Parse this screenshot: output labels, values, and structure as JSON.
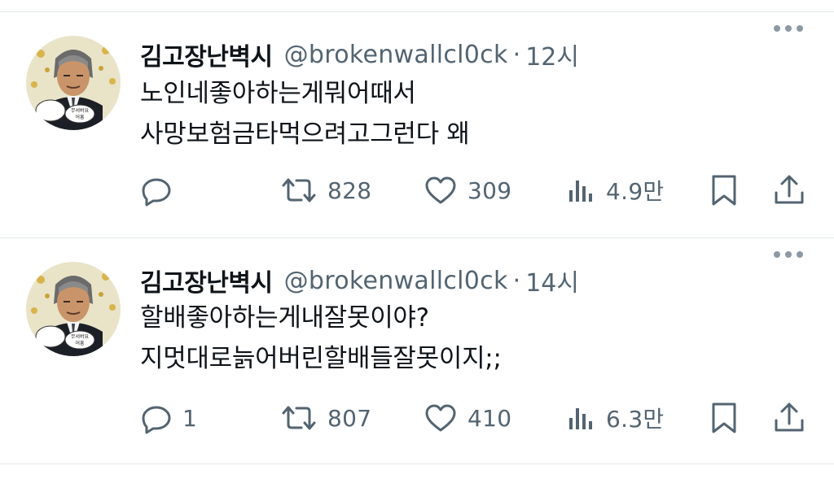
{
  "tweets": [
    {
      "display_name": "김고장난벽시",
      "handle": "@brokenwallcl0ck",
      "separator": "·",
      "time": "12시",
      "lines": [
        "노인네좋아하는게뭐어때서",
        "사망보험금타먹으려고그런다 왜"
      ],
      "reply_count": "",
      "retweet_count": "828",
      "like_count": "309",
      "view_count": "4.9만",
      "avatar_caption": "무서버요 어흥"
    },
    {
      "display_name": "김고장난벽시",
      "handle": "@brokenwallcl0ck",
      "separator": "·",
      "time": "14시",
      "lines": [
        "할배좋아하는게내잘못이야?",
        "지멋대로늙어버린할배들잘못이지;;"
      ],
      "reply_count": "1",
      "retweet_count": "807",
      "like_count": "410",
      "view_count": "6.3만",
      "avatar_caption": "무서버요 어흥"
    }
  ],
  "icons": [
    "more-icon",
    "reply-icon",
    "retweet-icon",
    "like-icon",
    "views-icon",
    "bookmark-icon",
    "share-icon"
  ],
  "colors": {
    "text": "#0f1419",
    "secondary": "#536471",
    "divider": "#e4e8eb",
    "background": "#ffffff"
  }
}
